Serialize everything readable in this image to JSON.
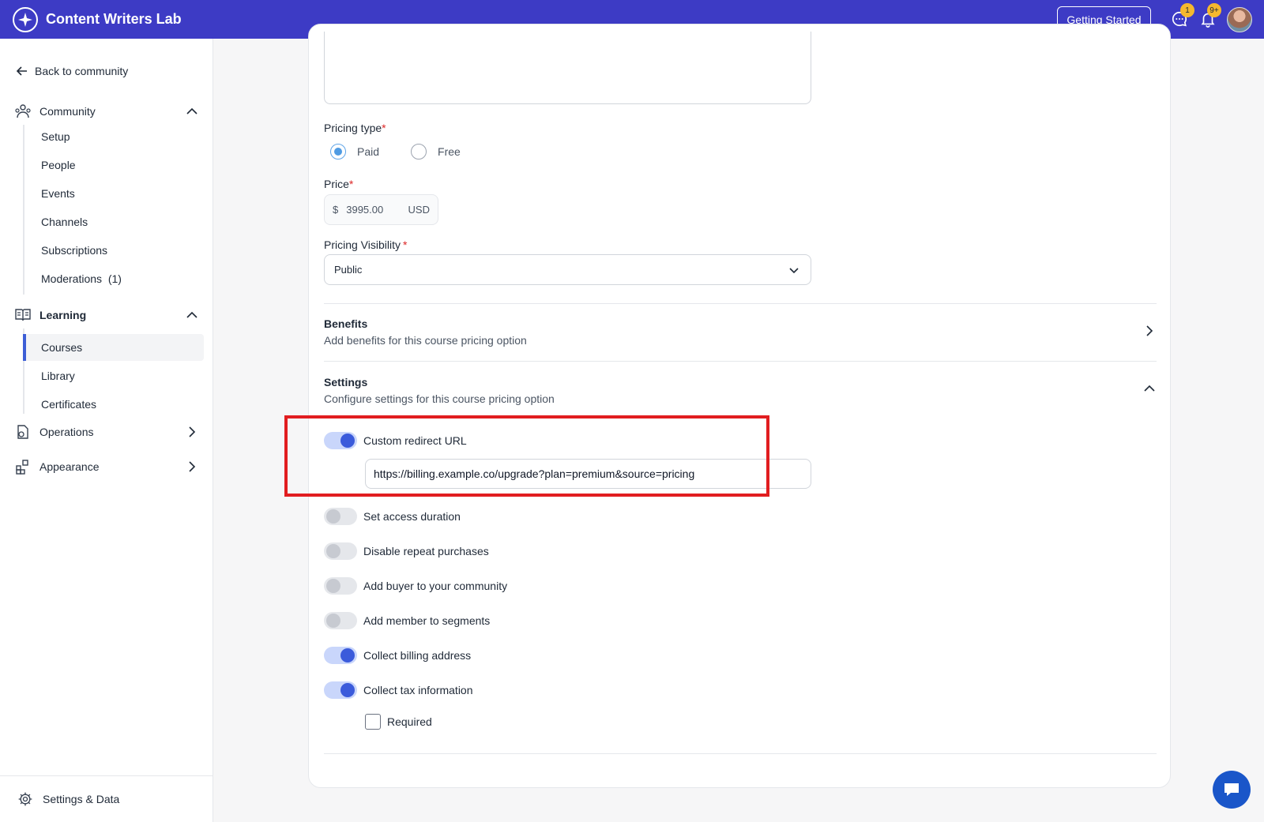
{
  "app": {
    "name": "Content Writers Lab"
  },
  "topbar": {
    "getting_started_label": "Getting Started",
    "messages_badge": "1",
    "notifications_badge": "9+"
  },
  "sidebar": {
    "back_label": "Back to community",
    "community": {
      "label": "Community",
      "items": [
        "Setup",
        "People",
        "Events",
        "Channels",
        "Subscriptions",
        "Moderations  (1)"
      ]
    },
    "learning": {
      "label": "Learning",
      "items": [
        "Courses",
        "Library",
        "Certificates"
      ],
      "active": "Courses"
    },
    "operations_label": "Operations",
    "appearance_label": "Appearance",
    "footer_label": "Settings & Data"
  },
  "form": {
    "pricing_type": {
      "label": "Pricing type",
      "required_mark": "*",
      "options": [
        "Paid",
        "Free"
      ],
      "selected": "Paid"
    },
    "price": {
      "label": "Price",
      "required_mark": "*",
      "currency_symbol": "$",
      "amount": "3995.00",
      "currency": "USD"
    },
    "pricing_visibility": {
      "label": "Pricing Visibility",
      "required_mark": "*",
      "value": "Public"
    },
    "benefits": {
      "title": "Benefits",
      "description": "Add benefits for this course pricing option"
    },
    "settings": {
      "title": "Settings",
      "description": "Configure settings for this course pricing option",
      "toggles": [
        {
          "label": "Custom redirect URL",
          "on": true
        },
        {
          "label": "Set access duration",
          "on": false
        },
        {
          "label": "Disable repeat purchases",
          "on": false
        },
        {
          "label": "Add buyer to your community",
          "on": false
        },
        {
          "label": "Add member to segments",
          "on": false
        },
        {
          "label": "Collect billing address",
          "on": true
        },
        {
          "label": "Collect tax information",
          "on": true
        }
      ],
      "redirect_url": "https://billing.example.co/upgrade?plan=premium&source=pricing",
      "required_checkbox_label": "Required",
      "required_checked": false
    }
  },
  "colors": {
    "brand": "#3d3bc5",
    "toggle_on": "#3b5bdb",
    "highlight": "#e11d20",
    "badge": "#f5b82e"
  }
}
